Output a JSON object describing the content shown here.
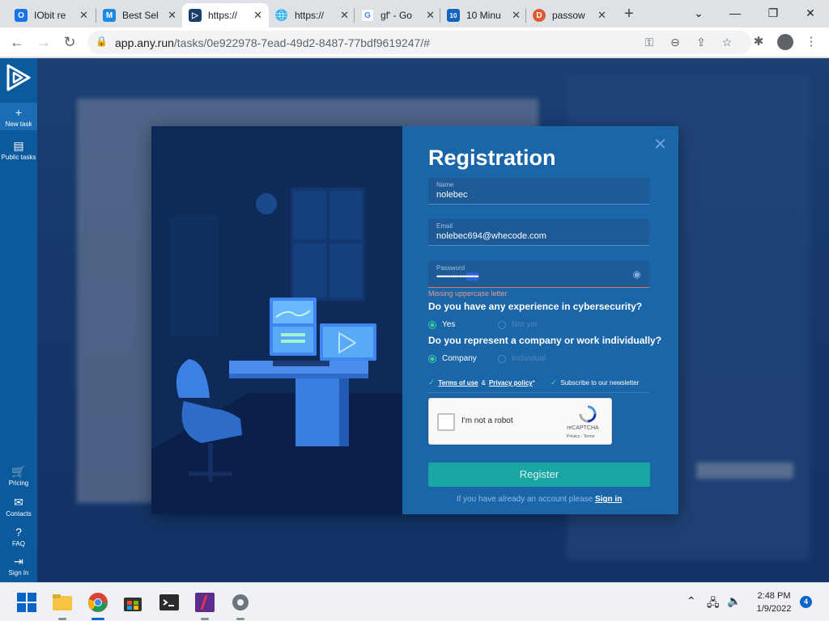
{
  "browser": {
    "tabs": [
      {
        "title": "IObit re",
        "favicon_color": "#1a73e8",
        "favicon": "O"
      },
      {
        "title": "Best Sel",
        "favicon_color": "#1e88e5",
        "favicon": "M"
      },
      {
        "title": "https://",
        "favicon_color": "#1a3f6b",
        "favicon": "▷",
        "active": true
      },
      {
        "title": "https://",
        "favicon_color": "#5f6368",
        "favicon": "🌐"
      },
      {
        "title": "gf' - Go",
        "favicon_color": "#ffffff",
        "favicon": "G"
      },
      {
        "title": "10 Minu",
        "favicon_color": "#1565c0",
        "favicon": "10"
      },
      {
        "title": "passow",
        "favicon_color": "#de5833",
        "favicon": "D"
      }
    ],
    "url": "app.any.run/tasks/0e922978-7ead-49d2-8487-77bdf9619247/#",
    "url_host": "app.any.run",
    "url_path": "/tasks/0e922978-7ead-49d2-8487-77bdf9619247/#"
  },
  "app_nav": {
    "top_items": [
      {
        "label": "New task",
        "icon": "plus-icon"
      },
      {
        "label": "Public tasks",
        "icon": "document-icon"
      }
    ],
    "bottom_items": [
      {
        "label": "Pricing",
        "icon": "cart-icon"
      },
      {
        "label": "Contacts",
        "icon": "mail-icon"
      },
      {
        "label": "FAQ",
        "icon": "help-icon"
      },
      {
        "label": "Sign In",
        "icon": "signin-icon"
      }
    ]
  },
  "modal": {
    "title": "Registration",
    "name_label": "Name",
    "name_value": "nolebec",
    "email_label": "Email",
    "email_value": "nolebec694@whecode.com",
    "password_label": "Password",
    "password_error": "Missing uppercase letter",
    "q1": "Do you have any experience in cybersecurity?",
    "q1_yes": "Yes",
    "q1_no": "Not yet",
    "q2": "Do you represent a company or work individually?",
    "q2_company": "Company",
    "q2_individual": "Individual",
    "terms_label": "Terms of use",
    "terms_and": "&",
    "privacy_label": "Privacy policy",
    "privacy_star": "*",
    "newsletter_label": "Subscribe to our newsletter",
    "captcha_text": "I'm not a robot",
    "captcha_brand": "reCAPTCHA",
    "captcha_links": "Privacy - Terms",
    "register_label": "Register",
    "already_text": "If you have already an account please",
    "signin_label": "Sign in"
  },
  "taskbar": {
    "time": "2:48 PM",
    "date": "1/9/2022",
    "notifications": "4"
  }
}
